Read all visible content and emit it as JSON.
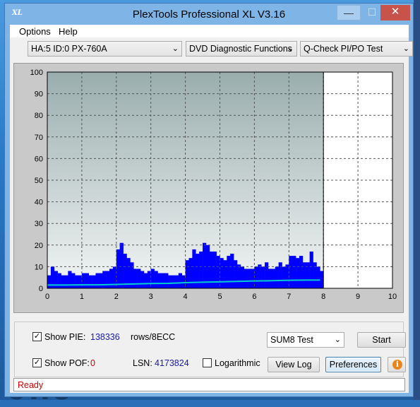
{
  "window": {
    "title": "PlexTools Professional XL V3.16",
    "app_icon_text": "XL",
    "minimize": "—",
    "maximize": "☐",
    "close": "✕"
  },
  "menu": {
    "options": "Options",
    "help": "Help"
  },
  "toolbar": {
    "drive": "HA:5 ID:0  PX-760A",
    "function": "DVD Diagnostic Functions",
    "test": "Q-Check PI/PO Test",
    "dropdown_arrow": "⌄"
  },
  "chart_data": {
    "type": "bar",
    "xlim": [
      0,
      10
    ],
    "ylim": [
      0,
      100
    ],
    "x_ticks": [
      "0",
      "1",
      "2",
      "3",
      "4",
      "5",
      "6",
      "7",
      "8",
      "9",
      "10"
    ],
    "y_ticks": [
      "0",
      "10",
      "20",
      "30",
      "40",
      "50",
      "60",
      "70",
      "80",
      "90",
      "100"
    ],
    "grid": true,
    "scan_end_x": 8,
    "cursor_x": 8,
    "series": [
      {
        "name": "PIE",
        "color": "#0000ff",
        "x": [
          0.0,
          0.1,
          0.2,
          0.3,
          0.4,
          0.5,
          0.6,
          0.7,
          0.8,
          0.9,
          1.0,
          1.1,
          1.2,
          1.3,
          1.4,
          1.5,
          1.6,
          1.7,
          1.8,
          1.9,
          2.0,
          2.1,
          2.2,
          2.3,
          2.4,
          2.5,
          2.6,
          2.7,
          2.8,
          2.9,
          3.0,
          3.1,
          3.2,
          3.3,
          3.4,
          3.5,
          3.6,
          3.7,
          3.8,
          3.9,
          4.0,
          4.1,
          4.2,
          4.3,
          4.4,
          4.5,
          4.6,
          4.7,
          4.8,
          4.9,
          5.0,
          5.1,
          5.2,
          5.3,
          5.4,
          5.5,
          5.6,
          5.7,
          5.8,
          5.9,
          6.0,
          6.1,
          6.2,
          6.3,
          6.4,
          6.5,
          6.6,
          6.7,
          6.8,
          6.9,
          7.0,
          7.1,
          7.2,
          7.3,
          7.4,
          7.5,
          7.6,
          7.7,
          7.8,
          7.9
        ],
        "y": [
          6,
          10,
          8,
          7,
          6,
          6,
          8,
          7,
          6,
          6,
          7,
          7,
          6,
          6,
          7,
          7,
          8,
          8,
          9,
          10,
          18,
          21,
          16,
          14,
          12,
          9,
          9,
          8,
          7,
          8,
          9,
          8,
          7,
          7,
          7,
          6,
          6,
          6,
          7,
          6,
          13,
          14,
          18,
          16,
          17,
          21,
          20,
          17,
          17,
          15,
          14,
          13,
          15,
          16,
          13,
          11,
          10,
          9,
          9,
          9,
          10,
          11,
          10,
          12,
          9,
          9,
          10,
          12,
          10,
          11,
          15,
          15,
          14,
          15,
          12,
          12,
          17,
          12,
          10,
          8
        ]
      },
      {
        "name": "PIE avg",
        "color": "#00cccc",
        "x": [
          0.0,
          0.5,
          1.0,
          1.5,
          2.0,
          2.5,
          3.0,
          3.5,
          4.0,
          4.5,
          5.0,
          5.5,
          6.0,
          6.5,
          7.0,
          7.5,
          7.9
        ],
        "y": [
          1.5,
          1.5,
          1.6,
          1.6,
          1.8,
          2.0,
          2.2,
          2.3,
          2.6,
          2.8,
          3.0,
          3.2,
          3.4,
          3.5,
          3.7,
          3.8,
          3.8
        ]
      }
    ]
  },
  "controls": {
    "show_pie_label": "Show PIE:",
    "pie_value": "138336",
    "pie_unit": "rows/8ECC",
    "show_pof_label": "Show POF:",
    "pof_value": "0",
    "lsn_label": "LSN:",
    "lsn_value": "4173824",
    "logarithmic_label": "Logarithmic",
    "sum_test": "SUM8 Test",
    "start": "Start",
    "view_log": "View Log",
    "preferences": "Preferences",
    "info_glyph": "i",
    "check_mark": "✓",
    "show_pie_checked": true,
    "show_pof_checked": true,
    "logarithmic_checked": false
  },
  "status": {
    "text": "Ready"
  },
  "background": {
    "text": "ows"
  }
}
